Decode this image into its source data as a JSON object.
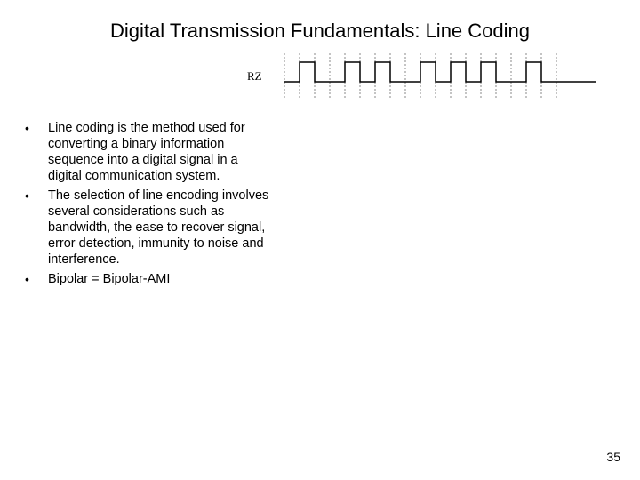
{
  "title": "Digital Transmission Fundamentals: Line Coding",
  "diagram_label": "RZ",
  "bullets": [
    "Line coding is the method used for converting a binary information sequence into a digital signal in a digital communication system.",
    "The selection of line encoding involves several considerations such as bandwidth, the ease to recover signal, error detection, immunity to noise and interference.",
    "Bipolar = Bipolar-AMI"
  ],
  "page_number": "35"
}
